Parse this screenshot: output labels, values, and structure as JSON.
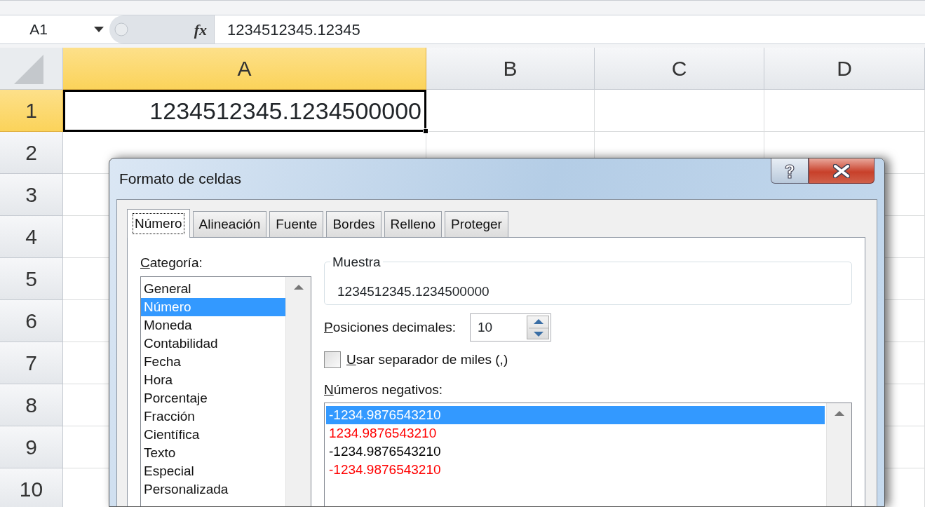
{
  "formula_bar": {
    "name_box": "A1",
    "function_button": "fx",
    "formula": "1234512345.12345"
  },
  "sheet": {
    "columns": [
      {
        "label": "A",
        "selected": true
      },
      {
        "label": "B",
        "selected": false
      },
      {
        "label": "C",
        "selected": false
      },
      {
        "label": "D",
        "selected": false
      }
    ],
    "rows": [
      {
        "label": "1",
        "selected": true
      },
      {
        "label": "2",
        "selected": false
      },
      {
        "label": "3",
        "selected": false
      },
      {
        "label": "4",
        "selected": false
      },
      {
        "label": "5",
        "selected": false
      },
      {
        "label": "6",
        "selected": false
      },
      {
        "label": "7",
        "selected": false
      },
      {
        "label": "8",
        "selected": false
      },
      {
        "label": "9",
        "selected": false
      },
      {
        "label": "10",
        "selected": false
      }
    ],
    "active_cell": {
      "value": "1234512345.1234500000"
    }
  },
  "dialog": {
    "title": "Formato de celdas",
    "tabs": [
      {
        "label": "Número",
        "selected": true
      },
      {
        "label": "Alineación",
        "selected": false
      },
      {
        "label": "Fuente",
        "selected": false
      },
      {
        "label": "Bordes",
        "selected": false
      },
      {
        "label": "Relleno",
        "selected": false
      },
      {
        "label": "Proteger",
        "selected": false
      }
    ],
    "category_label": "Categoría:",
    "categories": [
      {
        "label": "General",
        "selected": false
      },
      {
        "label": "Número",
        "selected": true
      },
      {
        "label": "Moneda",
        "selected": false
      },
      {
        "label": "Contabilidad",
        "selected": false
      },
      {
        "label": "Fecha",
        "selected": false
      },
      {
        "label": "Hora",
        "selected": false
      },
      {
        "label": "Porcentaje",
        "selected": false
      },
      {
        "label": "Fracción",
        "selected": false
      },
      {
        "label": "Científica",
        "selected": false
      },
      {
        "label": "Texto",
        "selected": false
      },
      {
        "label": "Especial",
        "selected": false
      },
      {
        "label": "Personalizada",
        "selected": false
      }
    ],
    "sample": {
      "label": "Muestra",
      "value": "1234512345.1234500000"
    },
    "decimal_places": {
      "label": "Posiciones decimales:",
      "value": "10"
    },
    "thousands_separator": {
      "label": "Usar separador de miles (,)",
      "checked": false
    },
    "negative_label": "Números negativos:",
    "negative_numbers": [
      {
        "text": "-1234.9876543210",
        "selected": true
      },
      {
        "text": "1234.9876543210",
        "color": "#ff0000",
        "selected": false
      },
      {
        "text": "-1234.9876543210",
        "color": "#000000",
        "selected": false
      },
      {
        "text": "-1234.9876543210",
        "color": "#ff0000",
        "selected": false
      }
    ]
  }
}
